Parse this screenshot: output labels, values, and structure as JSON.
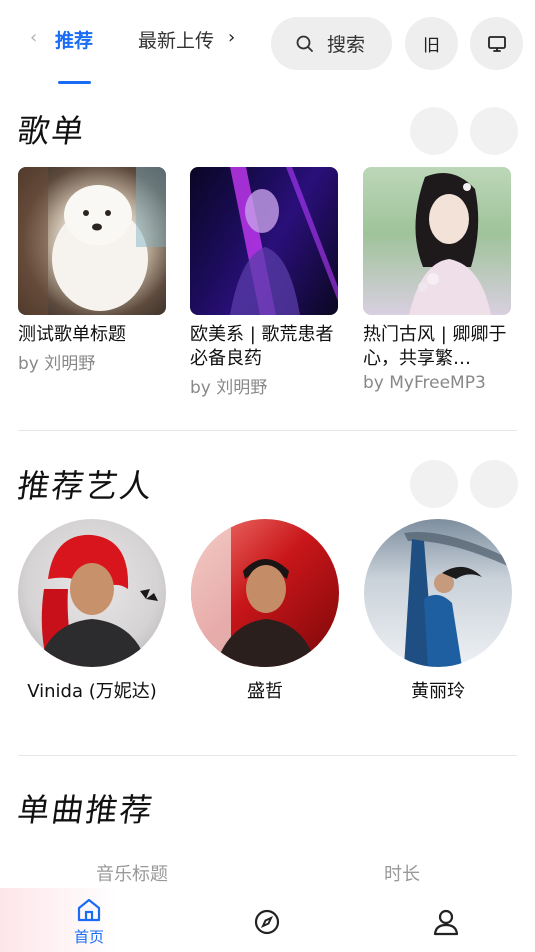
{
  "tabs": {
    "prev_glyph": "‹",
    "active_label": "推荐",
    "inactive_label": "最新上传",
    "next_glyph": "›"
  },
  "search": {
    "label": "搜索",
    "icon": "search-icon"
  },
  "old_button": {
    "label": "旧"
  },
  "tv_button": {
    "icon": "tv-icon"
  },
  "playlists": {
    "title": "歌单",
    "items": [
      {
        "title": "测试歌单标题",
        "byline": "by 刘明野"
      },
      {
        "title": "欧美系 | 歌荒患者必备良药",
        "byline": "by 刘明野"
      },
      {
        "title": "热门古风 | 卿卿于心，共享繁…",
        "byline": "by MyFreeMP3"
      }
    ]
  },
  "artists": {
    "title": "推荐艺人",
    "items": [
      {
        "name": "Vinida (万妮达)"
      },
      {
        "name": "盛哲"
      },
      {
        "name": "黄丽玲"
      }
    ]
  },
  "songs": {
    "title": "单曲推荐",
    "col_title": "音乐标题",
    "col_duration": "时长"
  },
  "bottom_nav": {
    "home_label": "首页",
    "accent": "#1a6cf5"
  }
}
